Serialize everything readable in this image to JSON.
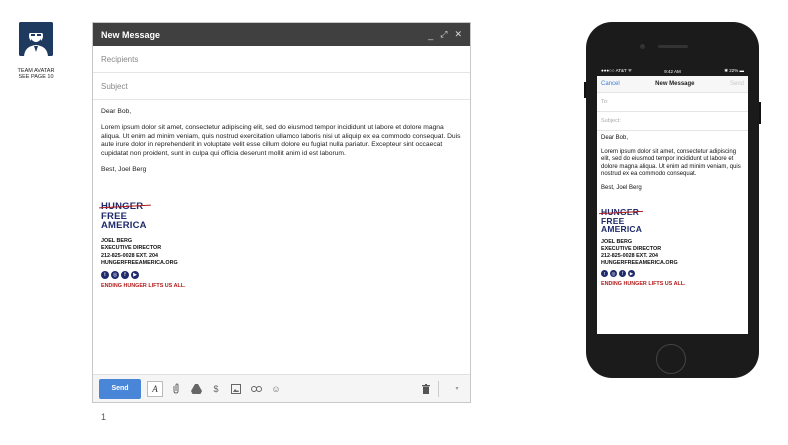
{
  "avatar": {
    "caption_line1": "TEAM AVATAR",
    "caption_line2": "SEE PAGE 10"
  },
  "compose": {
    "title": "New Message",
    "controls": {
      "minimize": "_",
      "expand": "⤢",
      "close": "✕"
    },
    "recipients_placeholder": "Recipients",
    "subject_placeholder": "Subject",
    "greeting": "Dear Bob,",
    "body": "Lorem ipsum dolor sit amet, consectetur adipiscing elit, sed do eiusmod tempor incididunt ut labore et dolore magna aliqua. Ut enim ad minim veniam, quis nostrud exercitation ullamco laboris nisi ut aliquip ex ea commodo consequat. Duis aute irure dolor in reprehenderit in voluptate velit esse cillum dolore eu fugiat nulla pariatur. Excepteur sint occaecat cupidatat non proident, sunt in culpa qui officia deserunt mollit anim id est laborum.",
    "closing": "Best,     Joel Berg",
    "toolbar": {
      "send_label": "Send",
      "format_label": "A"
    }
  },
  "signature": {
    "logo_line1": "HUNGER",
    "logo_line2": "FREE",
    "logo_line3": "AMERICA",
    "name": "JOEL BERG",
    "role": "EXECUTIVE DIRECTOR",
    "phone": "212-825-0028 EXT. 204",
    "website": "HUNGERFREEAMERICA.ORG",
    "tagline": "ENDING HUNGER LIFTS US ALL.",
    "social_icons": [
      "twitter-icon",
      "instagram-icon",
      "facebook-icon",
      "youtube-icon"
    ]
  },
  "phone": {
    "status_left": "●●●○○ AT&T ᯤ",
    "status_time": "9:42 AM",
    "status_right": "✱ 22% ▬",
    "cancel_label": "Cancel",
    "title": "New Message",
    "send_label": "Send",
    "to_label": "To:",
    "subject_label": "Subject:",
    "greeting": "Dear Bob,",
    "body": "Lorem ipsum dolor sit amet, consectetur adipiscing elit, sed do eiusmod tempor incididunt ut labore et dolore magna aliqua. Ut enim ad minim veniam, quis nostrud ex ea commodo consequat.",
    "closing": "Best,     Joel Berg"
  },
  "page_number": "1",
  "colors": {
    "brand_navy": "#1f2a6b",
    "brand_red": "#b31b1b",
    "send_blue": "#4a86d8",
    "titlebar": "#404040"
  }
}
